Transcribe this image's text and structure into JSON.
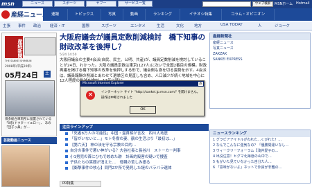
{
  "topbar": {
    "msn": "msn",
    "links": [
      "ニュース",
      "スポーツ",
      "ヤフー",
      "サービス一覧"
    ],
    "search_button": "ウェブ検索",
    "search_button2": "検索",
    "right_text": "MSNホーム",
    "hotmail": "Hotmail"
  },
  "header": {
    "logo": "産経ニュース",
    "nav1": [
      "速報",
      "トピックス",
      "写真",
      "動画",
      "ランキング",
      "イチオシ特集",
      "コラム・オピニオン"
    ],
    "nav2": [
      "主張",
      "事件",
      "政治",
      "経済・IT",
      "国際",
      "スポーツ",
      "エンタメ",
      "生活",
      "文化",
      "地方",
      "USA TODAY",
      "人",
      "ジョーク"
    ]
  },
  "paper": {
    "brand": "産経新聞",
    "en": "THE SANKEI SHIMBUN",
    "year": "2008年(平成20年)",
    "date": "05月24日",
    "weekday": "土",
    "caption": "博多総合車両所に留置されている「0系(ドクターイエロー」、 あの「団子っ鼻」が...",
    "link": "芸能動画ニュース"
  },
  "article": {
    "headline": "大阪府議会が議員定数削減検討　橋下知事の財政改革を後押し？",
    "dateline": "5/24 14:50",
    "body": "大阪府議会の主要4会派(自民、民主、公明、共産)が、議員定数削減を検討していることが24日、わかった。大阪の議員定数は東京(127人)に次いで全国2番目の規模。財政再建を掲げる橋下知事の改革を後押しする形で、議会側も身を切る姿勢を示す。4会派は、議員報酬の削減とあわせて選挙区の見直しも含め、人口減少が続く地域を中心に12人程度の削減を検討。11年以降に...",
    "more_label": "記事全文"
  },
  "dialog": {
    "title": "Microsoft Internet Explorer",
    "close": "×",
    "line1": "インターネット サイト \"http://sankei.jp.msn.com/\" を開けません。",
    "line2": "操作は中断されました",
    "ok": "OK"
  },
  "chuumoku": {
    "header": "注目ラインアップ",
    "items": [
      "「死者8万人の可能性」中国・温首相が言及　四川大地震",
      "「皆がいないと…」モト冬樹の妻、鶴の生活ぶり「最初は…」",
      "【第六天】 神の法を守る宗教の目的…",
      "自分の事件で悪い神がいる？大谷社長と長谷川　ストーカー判事",
      "小1男児の首にひもで絞めた跡　計画的殺害の疑いで捜査",
      "子供たちの笑顔が消えた…　母親の苦しみ語る",
      "【衝撃事件の核心】同門2か所で発見した謎のバラバラ遺体"
    ],
    "pr": "PR特集"
  },
  "right": {
    "box1_header": "産経新聞社",
    "box1_lines": [
      "産経ニュース",
      "写真ニュース",
      "ZAKZAK",
      "SANKEI EXPRESS"
    ],
    "box2_header": "ニュースランキング",
    "box2_lines": [
      "1 グラビアアイドルがわれた…くびれた！…",
      "2 なんでこんなに強気なの？「優勝間違いなし…",
      "3 ウィークリーフォーラム【浅井愛子の…",
      "4 出没注意！ヒグマ北海道の山中で…",
      "5 もがいた見ていなかった自分た人…",
      "6 「意味がないよ」ネットで外資が非難の…"
    ]
  },
  "colors": {
    "topbar": "#1c3f86",
    "nav": "#1d4a99",
    "headline": "#0f2c80",
    "dialog_title": "#0a246a",
    "error": "#dd2222"
  }
}
